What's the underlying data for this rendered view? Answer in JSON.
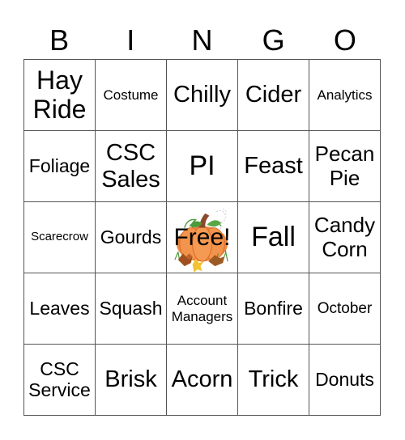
{
  "header": {
    "letters": [
      "B",
      "I",
      "N",
      "G",
      "O"
    ]
  },
  "free_space": {
    "label": "Free!",
    "icon": "pumpkin-icon"
  },
  "colors": {
    "grid_line": "#555555",
    "pumpkin": "#f08a40",
    "pumpkin_shade": "#d9692a",
    "stem": "#8a4a2a",
    "leaf": "#4c9a3a",
    "autumn_leaf_yellow": "#f2c230",
    "autumn_leaf_brown": "#a0501e"
  },
  "rows": [
    [
      "Hay\nRide",
      "Costume",
      "Chilly",
      "Cider",
      "Analytics"
    ],
    [
      "Foliage",
      "CSC\nSales",
      "PI",
      "Feast",
      "Pecan\nPie"
    ],
    [
      "Scarecrow",
      "Gourds",
      "Free!",
      "Fall",
      "Candy\nCorn"
    ],
    [
      "Leaves",
      "Squash",
      "Account\nManagers",
      "Bonfire",
      "October"
    ],
    [
      "CSC\nService",
      "Brisk",
      "Acorn",
      "Trick",
      "Donuts"
    ]
  ]
}
